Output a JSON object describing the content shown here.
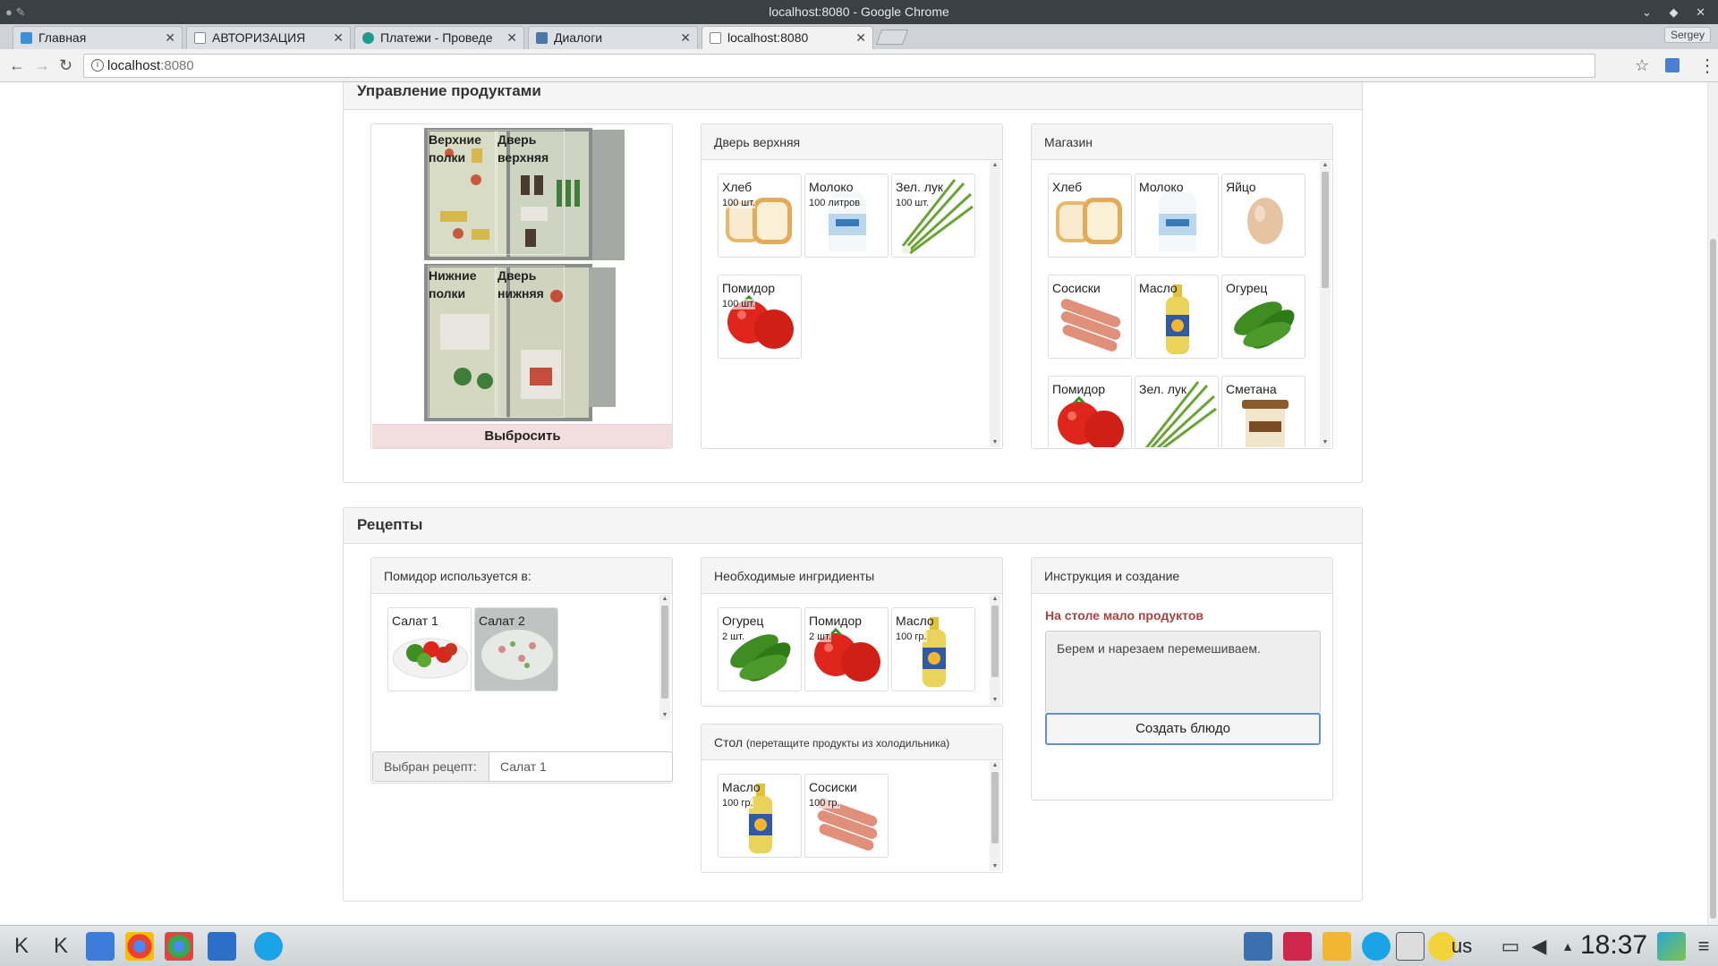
{
  "window": {
    "title": "localhost:8080 - Google Chrome"
  },
  "tabs": [
    {
      "label": "Главная",
      "color": "#3a8fd8"
    },
    {
      "label": "АВТОРИЗАЦИЯ",
      "color": "#9aa0a6"
    },
    {
      "label": "Платежи - Проведе",
      "color": "#1e9b8a"
    },
    {
      "label": "Диалоги",
      "color": "#4a76a8"
    },
    {
      "label": "localhost:8080",
      "color": "#9aa0a6"
    }
  ],
  "profile": "Sergey",
  "address": {
    "host": "localhost",
    "port": ":8080"
  },
  "products_panel": {
    "title": "Управление продуктами",
    "fridge": {
      "zones": [
        {
          "label": "Верхние полки"
        },
        {
          "label": "Дверь верхняя"
        },
        {
          "label": "Нижние полки"
        },
        {
          "label": "Дверь нижняя"
        }
      ],
      "throw_label": "Выбросить"
    },
    "door_upper": {
      "title": "Дверь верхняя",
      "items": [
        {
          "name": "Хлеб",
          "qty": "100 шт.",
          "icon": "bread-icon"
        },
        {
          "name": "Молоко",
          "qty": "100 литров",
          "icon": "milk-icon"
        },
        {
          "name": "Зел. лук",
          "qty": "100 шт.",
          "icon": "onion-icon"
        },
        {
          "name": "Помидор",
          "qty": "100 шт.",
          "icon": "tomato-icon"
        }
      ]
    },
    "shop": {
      "title": "Магазин",
      "items": [
        {
          "name": "Хлеб",
          "icon": "bread-icon"
        },
        {
          "name": "Молоко",
          "icon": "milk-icon"
        },
        {
          "name": "Яйцо",
          "icon": "egg-icon"
        },
        {
          "name": "Сосиски",
          "icon": "sausage-icon"
        },
        {
          "name": "Масло",
          "icon": "oil-icon"
        },
        {
          "name": "Огурец",
          "icon": "cucumber-icon"
        },
        {
          "name": "Помидор",
          "icon": "tomato-icon"
        },
        {
          "name": "Зел. лук",
          "icon": "onion-icon"
        },
        {
          "name": "Сметана",
          "icon": "sourcream-icon"
        }
      ]
    }
  },
  "recipes_panel": {
    "title": "Рецепты",
    "used_in": {
      "title": "Помидор используется в:",
      "items": [
        {
          "name": "Салат 1",
          "icon": "salad1-icon"
        },
        {
          "name": "Салат 2",
          "icon": "salad2-icon"
        }
      ]
    },
    "chosen": {
      "label": "Выбран рецепт:",
      "value": "Салат 1"
    },
    "ingredients": {
      "title": "Необходимые ингридиенты",
      "items": [
        {
          "name": "Огурец",
          "qty": "2 шт.",
          "icon": "cucumber-icon"
        },
        {
          "name": "Помидор",
          "qty": "2 шт.",
          "icon": "tomato-icon"
        },
        {
          "name": "Масло",
          "qty": "100 гр.",
          "icon": "oil-icon"
        }
      ]
    },
    "table": {
      "title": "Стол",
      "hint": "(перетащите продукты из холодильника)",
      "items": [
        {
          "name": "Масло",
          "qty": "100 гр.",
          "icon": "oil-icon"
        },
        {
          "name": "Сосиски",
          "qty": "100 гр.",
          "icon": "sausage-icon"
        }
      ]
    },
    "instructions": {
      "title": "Инструкция и создание",
      "warning": "На столе мало продуктов",
      "text": "Берем и нарезаем перемешиваем.",
      "button": "Создать блюдо"
    }
  },
  "taskbar": {
    "lang": "us",
    "clock": "18:37"
  }
}
